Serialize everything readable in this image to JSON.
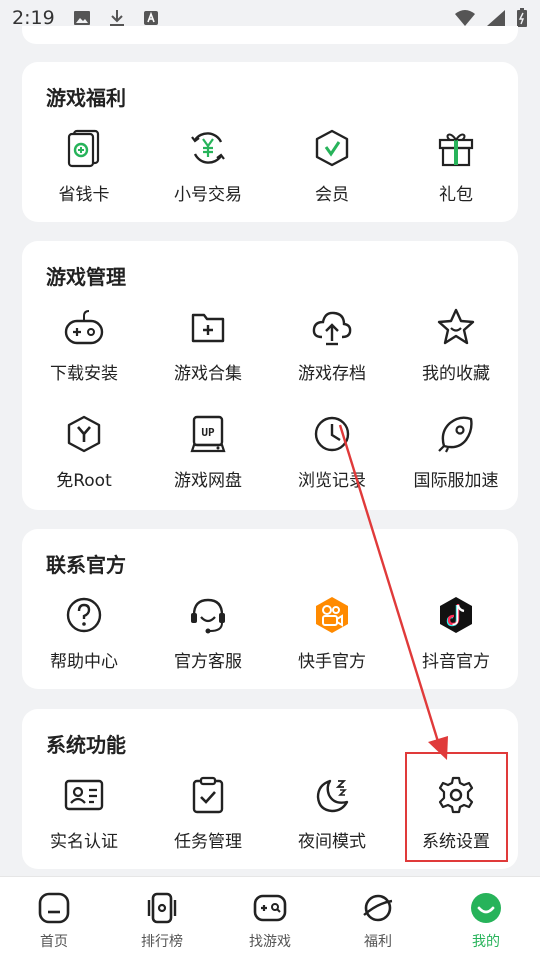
{
  "status": {
    "time": "2:19"
  },
  "cards": [
    {
      "title": "游戏福利",
      "items": [
        {
          "label": "省钱卡",
          "icon": "savings-card-icon"
        },
        {
          "label": "小号交易",
          "icon": "yen-trade-icon"
        },
        {
          "label": "会员",
          "icon": "member-shield-icon"
        },
        {
          "label": "礼包",
          "icon": "gift-icon"
        }
      ]
    },
    {
      "title": "游戏管理",
      "items": [
        {
          "label": "下载安装",
          "icon": "gamepad-icon"
        },
        {
          "label": "游戏合集",
          "icon": "folder-plus-icon"
        },
        {
          "label": "游戏存档",
          "icon": "cloud-upload-icon"
        },
        {
          "label": "我的收藏",
          "icon": "star-icon"
        },
        {
          "label": "免Root",
          "icon": "hex-y-icon"
        },
        {
          "label": "游戏网盘",
          "icon": "up-drive-icon"
        },
        {
          "label": "浏览记录",
          "icon": "clock-icon"
        },
        {
          "label": "国际服加速",
          "icon": "rocket-icon"
        }
      ]
    },
    {
      "title": "联系官方",
      "items": [
        {
          "label": "帮助中心",
          "icon": "help-icon"
        },
        {
          "label": "官方客服",
          "icon": "headset-icon"
        },
        {
          "label": "快手官方",
          "icon": "kuaishou-icon"
        },
        {
          "label": "抖音官方",
          "icon": "douyin-icon"
        }
      ]
    },
    {
      "title": "系统功能",
      "items": [
        {
          "label": "实名认证",
          "icon": "id-card-icon"
        },
        {
          "label": "任务管理",
          "icon": "clipboard-check-icon"
        },
        {
          "label": "夜间模式",
          "icon": "moon-icon"
        },
        {
          "label": "系统设置",
          "icon": "gear-icon"
        }
      ]
    }
  ],
  "nav": [
    {
      "label": "首页",
      "icon": "home-icon"
    },
    {
      "label": "排行榜",
      "icon": "rank-icon"
    },
    {
      "label": "找游戏",
      "icon": "find-game-icon"
    },
    {
      "label": "福利",
      "icon": "planet-icon"
    },
    {
      "label": "我的",
      "icon": "profile-icon"
    }
  ],
  "colors": {
    "accent": "#27b35a",
    "annotation": "#e03a3a"
  }
}
